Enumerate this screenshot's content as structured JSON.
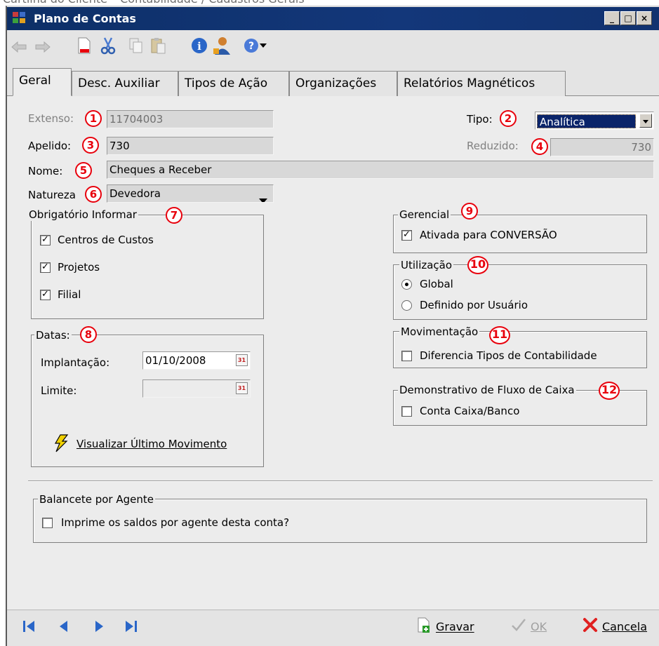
{
  "app_caption": "Cartilha do Cliente – Contabilidade / Cadastros Gerais",
  "window": {
    "title": "Plano de Contas",
    "minimize": "_",
    "maximize": "□",
    "close": "×"
  },
  "colors": {
    "titlebar": "#13377a",
    "selection": "#0a246a",
    "badge": "#e8000c",
    "panel": "#ececec"
  },
  "toolbar": {
    "icons": [
      "undo-icon",
      "redo-icon",
      "new-document-icon",
      "cut-icon",
      "copy-icon",
      "paste-icon",
      "info-icon",
      "user-icon",
      "help-icon",
      "dropdown-arrow-icon"
    ]
  },
  "tabs": [
    {
      "label": "Geral",
      "active": true
    },
    {
      "label": "Desc. Auxiliar"
    },
    {
      "label": "Tipos de Ação"
    },
    {
      "label": "Organizações"
    },
    {
      "label": "Relatórios Magnéticos"
    }
  ],
  "form": {
    "extenso_label": "Extenso:",
    "extenso_value": "11704003",
    "tipo_label": "Tipo:",
    "tipo_value": "Analítica",
    "apelido_label": "Apelido:",
    "apelido_value": "730",
    "reduzido_label": "Reduzido:",
    "reduzido_value": "730",
    "nome_label": "Nome:",
    "nome_value": "Cheques a Receber",
    "natureza_label": "Natureza",
    "natureza_value": "Devedora"
  },
  "badges": [
    "1",
    "2",
    "3",
    "4",
    "5",
    "6",
    "7",
    "8",
    "9",
    "10",
    "11",
    "12"
  ],
  "obrigatorio": {
    "title": "Obrigatório Informar",
    "items": [
      {
        "label": "Centros de Custos",
        "checked": true
      },
      {
        "label": "Projetos",
        "checked": true
      },
      {
        "label": "Filial",
        "checked": true
      }
    ]
  },
  "datas": {
    "title": "Datas:",
    "implantacao_label": "Implantação:",
    "implantacao_value": "01/10/2008",
    "limite_label": "Limite:",
    "limite_value": "",
    "calendar_glyph": "31",
    "visualizar_label": "Visualizar Último Movimento"
  },
  "gerencial": {
    "title": "Gerencial",
    "checkbox_label": "Ativada para CONVERSÃO",
    "checked": true
  },
  "utilizacao": {
    "title": "Utilização",
    "options": [
      "Global",
      "Definido por Usuário"
    ],
    "selected": "Global"
  },
  "movimentacao": {
    "title": "Movimentação",
    "checkbox_label": "Diferencia Tipos de Contabilidade",
    "checked": false
  },
  "fluxo": {
    "title": "Demonstrativo de Fluxo de Caixa",
    "checkbox_label": "Conta Caixa/Banco",
    "checked": false
  },
  "balancete": {
    "title": "Balancete por Agente",
    "checkbox_label": "Imprime os saldos por agente desta conta?",
    "checked": false
  },
  "check_glyph": "✓",
  "bottom": {
    "nav": [
      "first-icon",
      "previous-icon",
      "next-icon",
      "last-icon"
    ],
    "gravar": "Gravar",
    "ok": "OK",
    "cancela": "Cancela"
  }
}
